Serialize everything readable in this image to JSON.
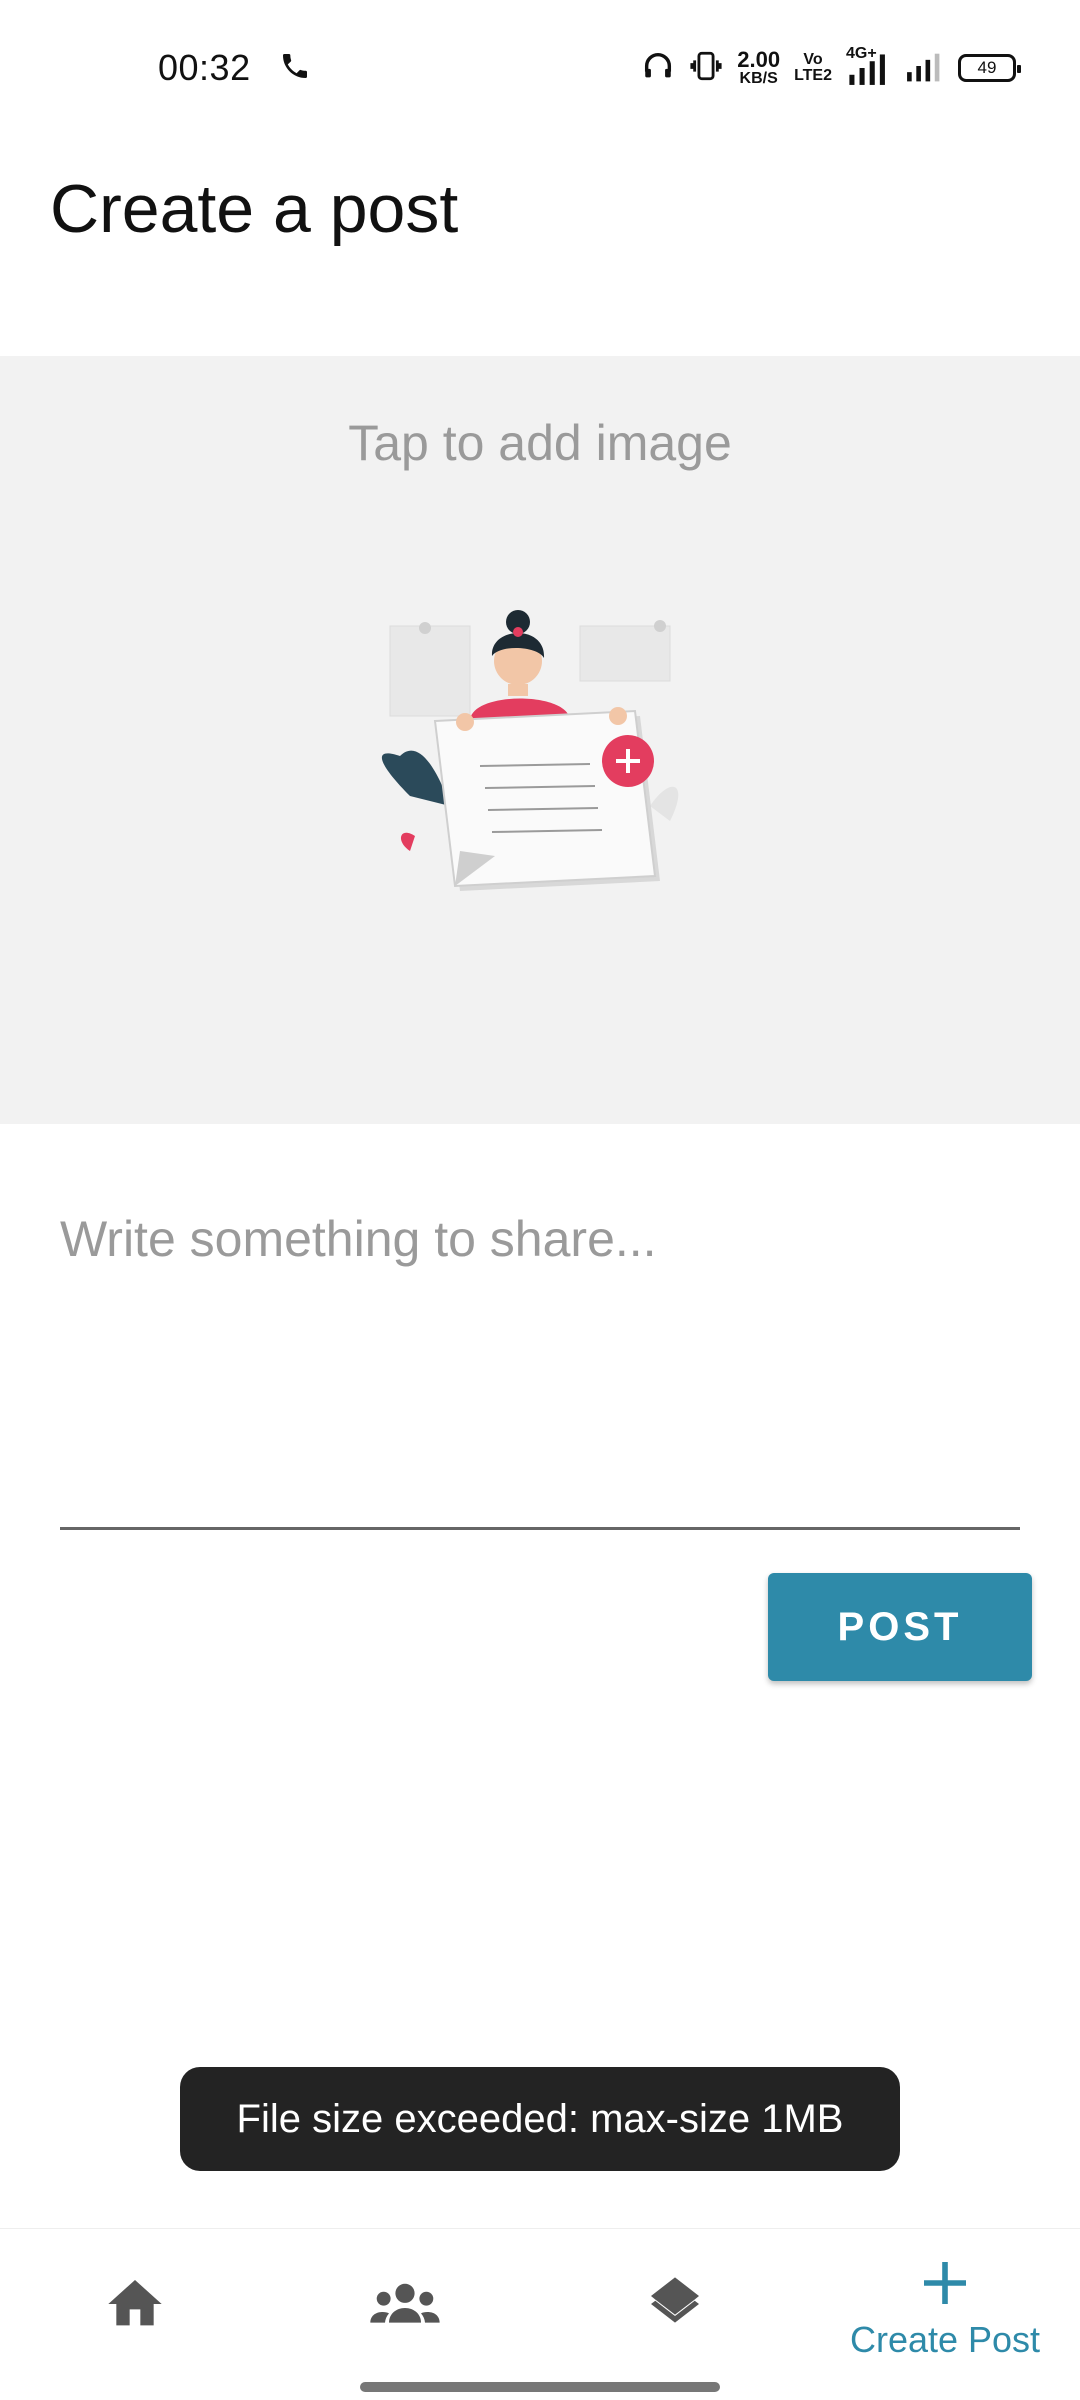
{
  "status_bar": {
    "time": "00:32",
    "net_speed_value": "2.00",
    "net_speed_unit": "KB/S",
    "volte_top": "Vo",
    "volte_bottom": "LTE2",
    "network_type": "4G+",
    "battery_level": "49",
    "icons": [
      "phone-call-icon",
      "headphones-icon",
      "vibrate-icon",
      "signal-icon",
      "signal-icon",
      "battery-icon"
    ]
  },
  "page": {
    "title": "Create a post"
  },
  "image_picker": {
    "hint": "Tap to add image"
  },
  "post_input": {
    "placeholder": "Write something to share...",
    "value": ""
  },
  "actions": {
    "post_label": "POST"
  },
  "toast": {
    "message": "File size exceeded: max-size 1MB"
  },
  "bottom_nav": {
    "items": [
      {
        "icon": "home-icon",
        "label": "",
        "active": false
      },
      {
        "icon": "people-icon",
        "label": "",
        "active": false
      },
      {
        "icon": "layers-icon",
        "label": "",
        "active": false
      },
      {
        "icon": "plus-icon",
        "label": "Create Post",
        "active": true
      }
    ]
  },
  "colors": {
    "accent": "#2e8aa9",
    "nav_icon": "#555555",
    "image_area_bg": "#f2f2f2",
    "toast_bg": "#232323",
    "placeholder": "#9a9a9a"
  }
}
